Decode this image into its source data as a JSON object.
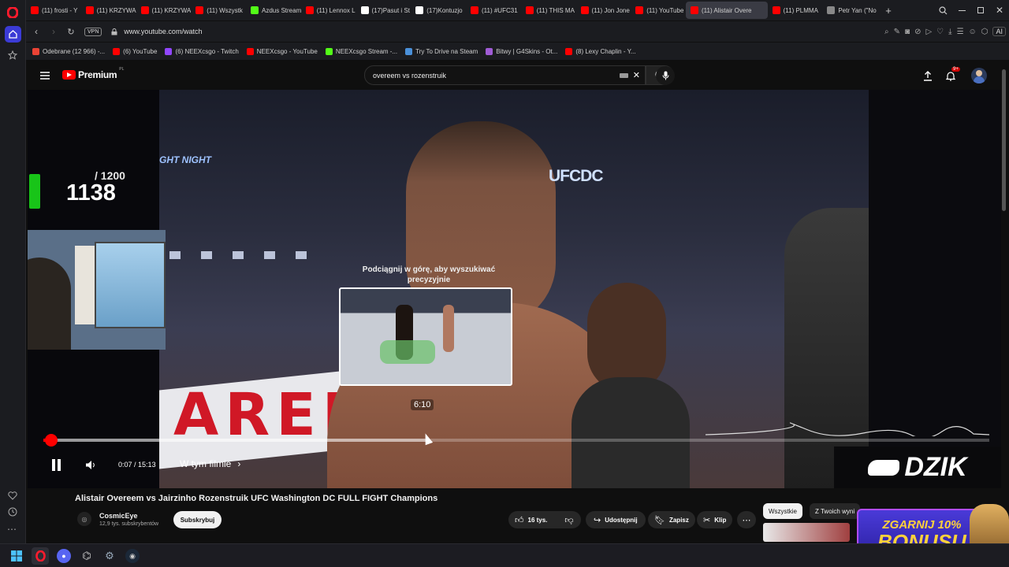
{
  "browser": {
    "tabs": [
      {
        "label": "(11) frosti - Y",
        "color": "#ff0000"
      },
      {
        "label": "(11) KRZYWA",
        "color": "#ff0000"
      },
      {
        "label": "(11) KRZYWA",
        "color": "#ff0000"
      },
      {
        "label": "(11) Wszystk",
        "color": "#ff0000"
      },
      {
        "label": "Azdus Stream",
        "color": "#53fc18"
      },
      {
        "label": "(11) Lennox L",
        "color": "#ff0000"
      },
      {
        "label": "(17)Pasut i St",
        "color": "#ffffff"
      },
      {
        "label": "(17)Kontuzjo",
        "color": "#ffffff"
      },
      {
        "label": "(11) #UFC31",
        "color": "#ff0000"
      },
      {
        "label": "(11) THIS MA",
        "color": "#ff0000"
      },
      {
        "label": "(11) Jon Jone",
        "color": "#ff0000"
      },
      {
        "label": "(11) YouTube",
        "color": "#ff0000"
      },
      {
        "label": "(11) Alistair Overe",
        "color": "#ff0000",
        "active": true
      },
      {
        "label": "(11) PLMMA",
        "color": "#ff0000"
      },
      {
        "label": "Petr Yan (\"No",
        "color": "#888888"
      }
    ],
    "url": "www.youtube.com/watch",
    "vpn_label": "VPN",
    "ai_label": "AI",
    "bookmarks": [
      {
        "label": "Odebrane (12 966) -...",
        "color": "#ea4335"
      },
      {
        "label": "(6) YouTube",
        "color": "#ff0000"
      },
      {
        "label": "(6) NEEXcsgo - Twitch",
        "color": "#9146ff"
      },
      {
        "label": "NEEXcsgo - YouTube",
        "color": "#ff0000"
      },
      {
        "label": "NEEXcsgo Stream -...",
        "color": "#53fc18"
      },
      {
        "label": "Try To Drive na Steam",
        "color": "#4a90d9"
      },
      {
        "label": "Bitwy | G4Skins - Ot...",
        "color": "#a05cd6"
      },
      {
        "label": "(8) Lexy Chaplin - Y...",
        "color": "#ff0000"
      }
    ]
  },
  "youtube": {
    "logo_text": "Premium",
    "logo_country": "PL",
    "search_query": "overeem vs rozenstruik",
    "notification_count": "9+",
    "video": {
      "title": "Alistair Overeem vs Jairzinho Rozenstruik UFC Washington DC FULL FIGHT Champions",
      "channel": "CosmicEye",
      "subscribers": "12,9 tys. subskrybentów",
      "subscribe_label": "Subskrybuj",
      "likes": "16 tys.",
      "share_label": "Udostępnij",
      "save_label": "Zapisz",
      "clip_label": "Klip",
      "current_time": "0:07",
      "duration": "15:13",
      "in_video_label": "W tym filmie",
      "hover_time": "6:10",
      "seek_hint": "Podciągnij w górę, aby wyszukiwać precyzyjnie",
      "progress": 0.008,
      "hover_position": 0.405,
      "overlay_brand_left": "GHT NIGHT",
      "overlay_brand_right": "UFCDC",
      "arena_text": "AREN"
    },
    "chips": [
      "Wszystkie",
      "Z Twoich wyni"
    ],
    "stream_counter": {
      "current": "1138",
      "total": "/ 1200"
    },
    "sponsor": {
      "brand": "DZIK",
      "promo_line1": "ZGARNIJ 10%",
      "promo_line2": "BONUSU"
    }
  },
  "colors": {
    "accent": "#ff0000",
    "opera": "#ff1b2d",
    "sponsor_blue": "#3b3bd6"
  }
}
